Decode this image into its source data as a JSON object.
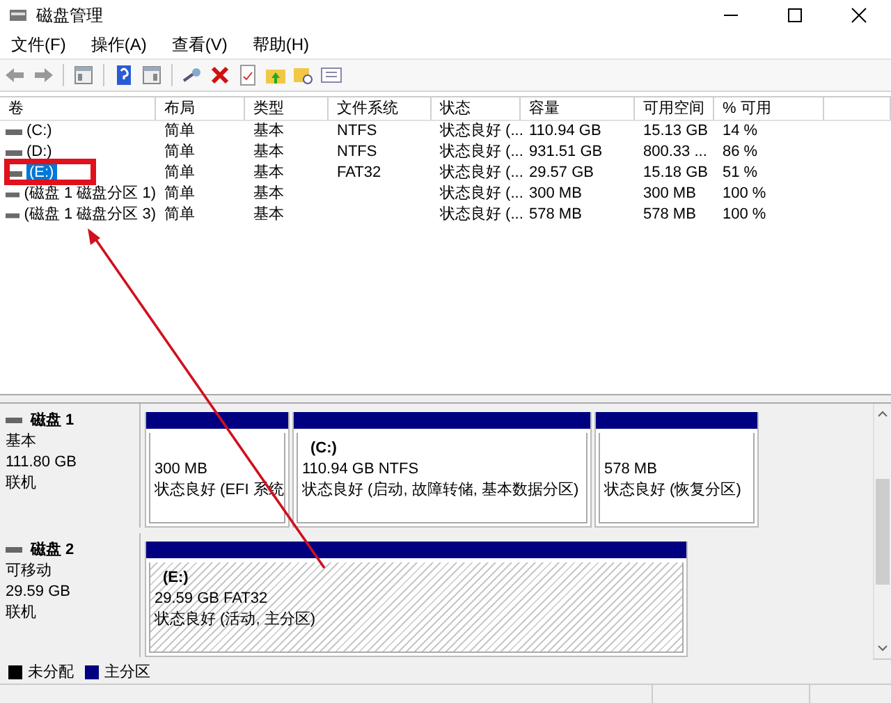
{
  "window": {
    "title": "磁盘管理"
  },
  "menu": [
    "文件(F)",
    "操作(A)",
    "查看(V)",
    "帮助(H)"
  ],
  "table": {
    "columns": [
      "卷",
      "布局",
      "类型",
      "文件系统",
      "状态",
      "容量",
      "可用空间",
      "% 可用"
    ],
    "rows": [
      {
        "cells": [
          "(C:)",
          "简单",
          "基本",
          "NTFS",
          "状态良好 (...",
          "110.94 GB",
          "15.13 GB",
          "14 %"
        ],
        "selected": false
      },
      {
        "cells": [
          "(D:)",
          "简单",
          "基本",
          "NTFS",
          "状态良好 (...",
          "931.51 GB",
          "800.33 ...",
          "86 %"
        ],
        "selected": false
      },
      {
        "cells": [
          "(E:)",
          "简单",
          "基本",
          "FAT32",
          "状态良好 (...",
          "29.57 GB",
          "15.18 GB",
          "51 %"
        ],
        "selected": true
      },
      {
        "cells": [
          "(磁盘 1 磁盘分区 1)",
          "简单",
          "基本",
          "",
          "状态良好 (...",
          "300 MB",
          "300 MB",
          "100 %"
        ],
        "selected": false
      },
      {
        "cells": [
          "(磁盘 1 磁盘分区 3)",
          "简单",
          "基本",
          "",
          "状态良好 (...",
          "578 MB",
          "578 MB",
          "100 %"
        ],
        "selected": false
      }
    ]
  },
  "disks": [
    {
      "name": "磁盘 1",
      "type": "基本",
      "size": "111.80 GB",
      "status": "联机",
      "partitions": [
        {
          "size": "300 MB",
          "status": "状态良好 (EFI 系统",
          "kind": "primary",
          "selected": false
        },
        {
          "name": "(C:)",
          "size": "110.94 GB NTFS",
          "status": "状态良好 (启动, 故障转储, 基本数据分区)",
          "kind": "primary",
          "selected": false
        },
        {
          "size": "578 MB",
          "status": "状态良好 (恢复分区)",
          "kind": "primary",
          "selected": false
        }
      ]
    },
    {
      "name": "磁盘 2",
      "type": "可移动",
      "size": "29.59 GB",
      "status": "联机",
      "partitions": [
        {
          "name": "(E:)",
          "size": "29.59 GB FAT32",
          "status": "状态良好 (活动, 主分区)",
          "kind": "primary",
          "selected": true
        }
      ]
    }
  ],
  "legend": [
    {
      "label": "未分配",
      "color": "#000000"
    },
    {
      "label": "主分区",
      "color": "#000080"
    }
  ]
}
